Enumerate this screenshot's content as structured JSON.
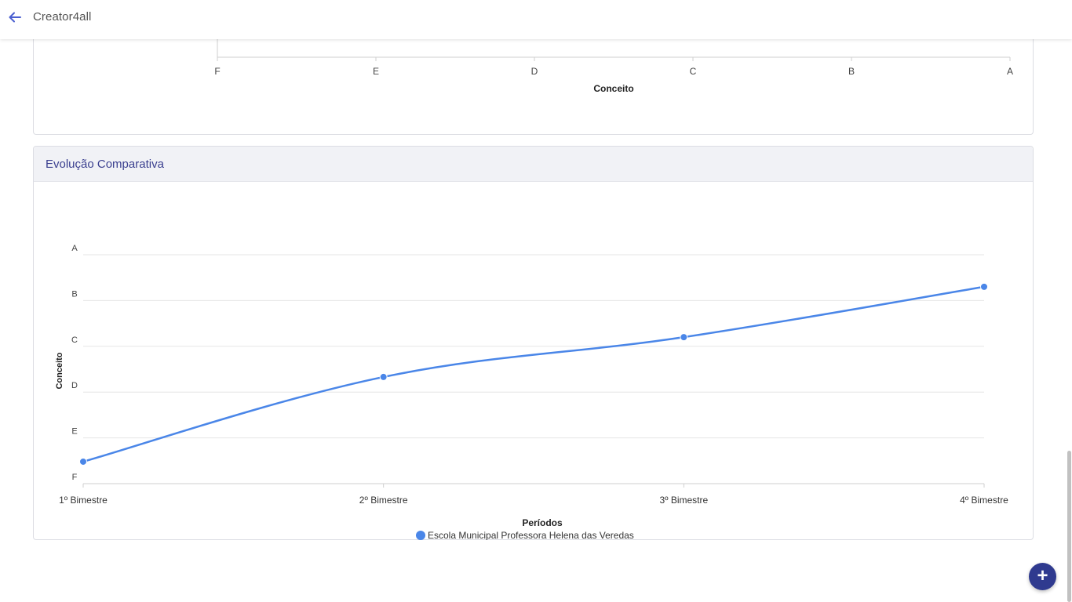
{
  "app": {
    "title": "Creator4all"
  },
  "top_chart": {
    "xlabel": "Conceito",
    "ticks": [
      "F",
      "E",
      "D",
      "C",
      "B",
      "A"
    ]
  },
  "evolution": {
    "title": "Evolução Comparativa"
  },
  "chart_data": {
    "type": "line",
    "title": "",
    "xlabel": "Períodos",
    "ylabel": "Conceito",
    "categories": [
      "1º Bimestre",
      "2º Bimestre",
      "3º Bimestre",
      "4º Bimestre"
    ],
    "y_ticks": [
      "F",
      "E",
      "D",
      "C",
      "B",
      "A"
    ],
    "ylim": [
      0,
      5
    ],
    "series": [
      {
        "name": "Escola Municipal Professora Helena das Veredas",
        "values": [
          0.48,
          2.33,
          3.2,
          4.3
        ],
        "color": "#4a86e8"
      }
    ],
    "grid": true,
    "legend": "bottom-center",
    "smooth": true
  },
  "fab": {
    "label": "+"
  },
  "colors": {
    "accent": "#2f3a8f",
    "line": "#4a86e8",
    "title": "#3a3f8f"
  }
}
